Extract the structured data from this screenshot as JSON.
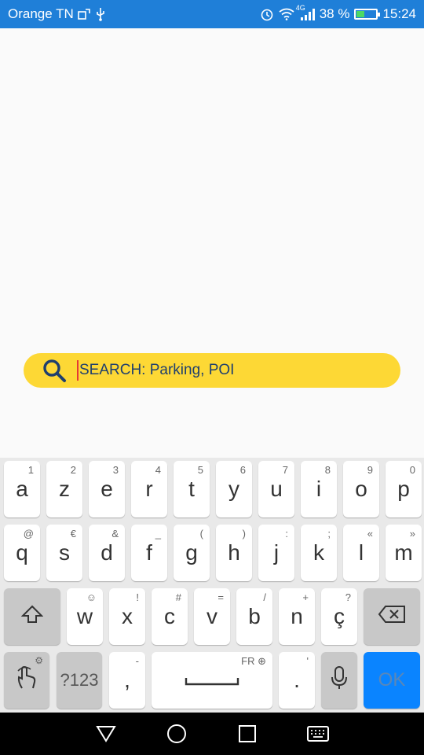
{
  "status_bar": {
    "carrier": "Orange TN",
    "network_type": "4G",
    "battery_percent": "38 %",
    "time": "15:24",
    "battery_level": 0.38,
    "icons": [
      "carrier-extra-icon",
      "usb-icon",
      "alarm-icon",
      "wifi-icon",
      "signal-icon",
      "battery-icon"
    ]
  },
  "search": {
    "placeholder": "SEARCH: Parking, POI"
  },
  "keyboard": {
    "row1": [
      {
        "main": "a",
        "sec": "1"
      },
      {
        "main": "z",
        "sec": "2"
      },
      {
        "main": "e",
        "sec": "3"
      },
      {
        "main": "r",
        "sec": "4"
      },
      {
        "main": "t",
        "sec": "5"
      },
      {
        "main": "y",
        "sec": "6"
      },
      {
        "main": "u",
        "sec": "7"
      },
      {
        "main": "i",
        "sec": "8"
      },
      {
        "main": "o",
        "sec": "9"
      },
      {
        "main": "p",
        "sec": "0"
      }
    ],
    "row2": [
      {
        "main": "q",
        "sec": "@"
      },
      {
        "main": "s",
        "sec": "€"
      },
      {
        "main": "d",
        "sec": "&"
      },
      {
        "main": "f",
        "sec": "_"
      },
      {
        "main": "g",
        "sec": "("
      },
      {
        "main": "h",
        "sec": ")"
      },
      {
        "main": "j",
        "sec": ":"
      },
      {
        "main": "k",
        "sec": ";"
      },
      {
        "main": "l",
        "sec": "«"
      },
      {
        "main": "m",
        "sec": "»"
      }
    ],
    "row3": [
      {
        "main": "w",
        "sec": "☺"
      },
      {
        "main": "x",
        "sec": "!"
      },
      {
        "main": "c",
        "sec": "#"
      },
      {
        "main": "v",
        "sec": "="
      },
      {
        "main": "b",
        "sec": "/"
      },
      {
        "main": "n",
        "sec": "+"
      },
      {
        "main": "ç",
        "sec": "?"
      }
    ],
    "symbols_label": "?123",
    "comma": {
      "main": ",",
      "sec": "-"
    },
    "space_lang": "FR",
    "period": {
      "main": ".",
      "sec": "'"
    },
    "ok_label": "OK"
  },
  "colors": {
    "status_bar": "#1f7fd8",
    "search_bar": "#fdd835",
    "ok_key": "#0a84ff",
    "caret": "#e53935"
  }
}
